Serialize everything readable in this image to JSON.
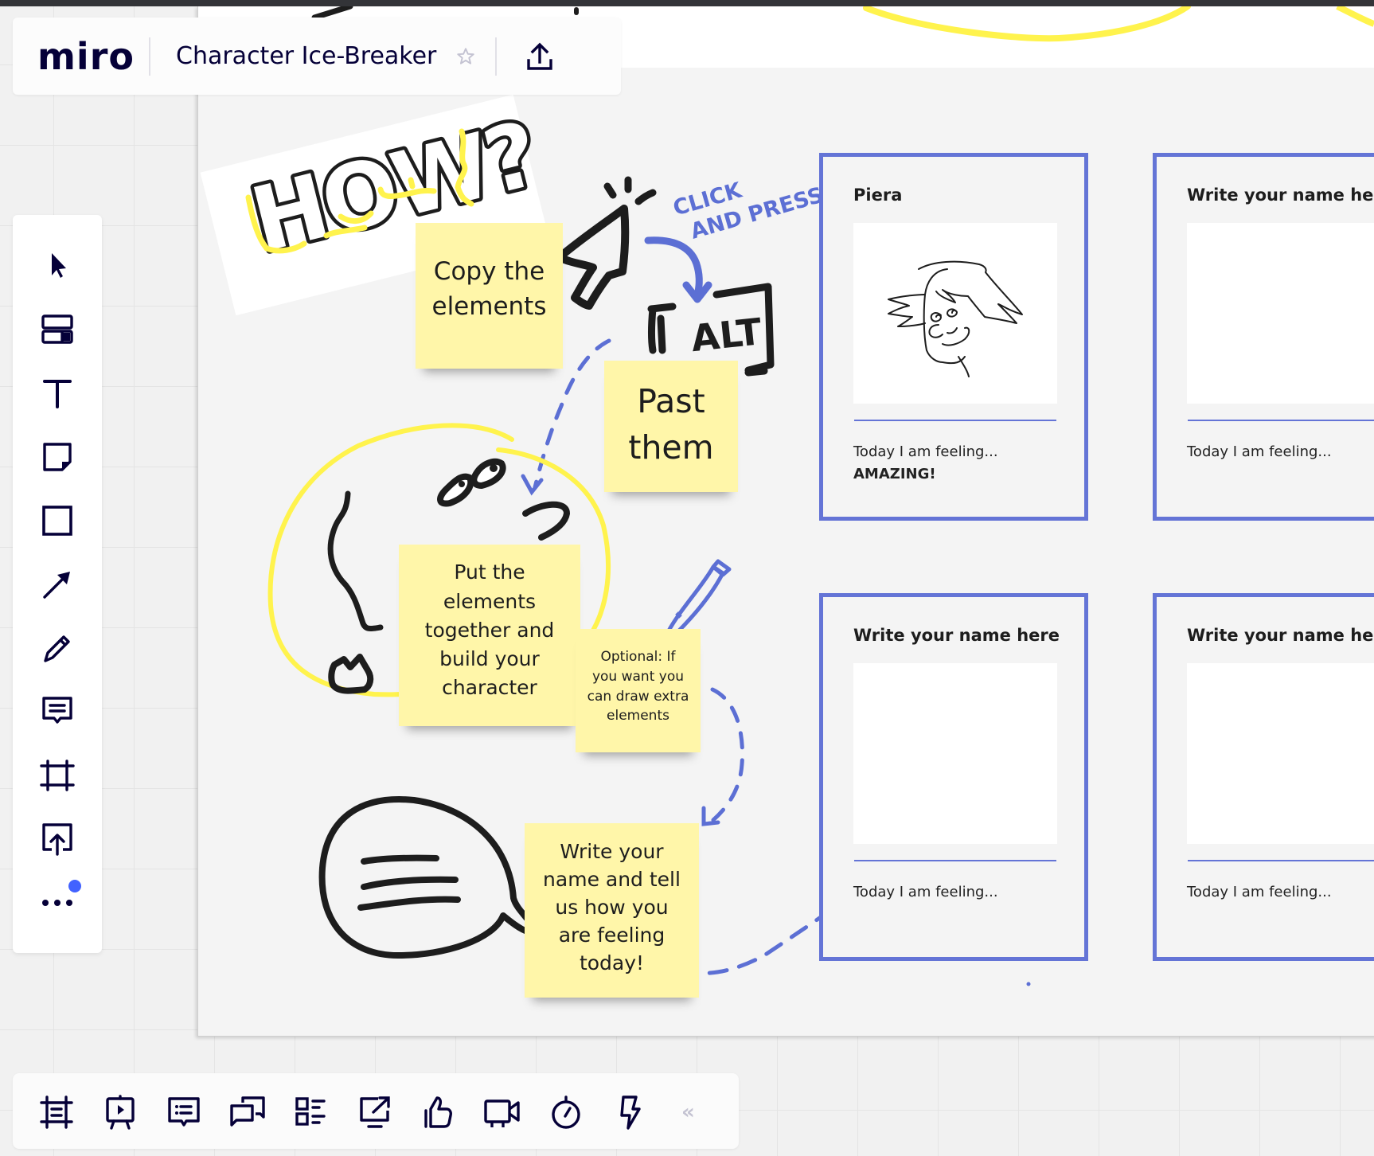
{
  "app": {
    "logo": "miro",
    "board_title": "Character Ice-Breaker",
    "header_icons": [
      "star-icon",
      "share-upload-icon"
    ]
  },
  "colors": {
    "brand_dark": "#050038",
    "card_border": "#6474d6",
    "sticky": "#fff6a9",
    "highlighter": "#fff34d",
    "notification_dot": "#4262ff",
    "ink_blue": "#5c6fd4"
  },
  "left_toolbar": {
    "tools": [
      {
        "id": "select",
        "icon": "cursor-arrow-icon"
      },
      {
        "id": "templates",
        "icon": "templates-icon"
      },
      {
        "id": "text",
        "icon": "text-icon"
      },
      {
        "id": "sticky-note",
        "icon": "sticky-note-icon"
      },
      {
        "id": "shape",
        "icon": "square-shape-icon"
      },
      {
        "id": "connection-line",
        "icon": "arrow-line-icon"
      },
      {
        "id": "pen",
        "icon": "pen-icon"
      },
      {
        "id": "comment",
        "icon": "comment-icon"
      },
      {
        "id": "frame",
        "icon": "frame-icon"
      },
      {
        "id": "upload",
        "icon": "upload-icon"
      },
      {
        "id": "more",
        "icon": "more-dots-icon"
      }
    ],
    "more_has_notification": true
  },
  "bottom_toolbar": {
    "tools": [
      {
        "id": "frames",
        "icon": "frames-icon"
      },
      {
        "id": "presentation",
        "icon": "presentation-icon"
      },
      {
        "id": "comments",
        "icon": "comments-icon"
      },
      {
        "id": "chat",
        "icon": "chat-icon"
      },
      {
        "id": "cards",
        "icon": "card-list-icon"
      },
      {
        "id": "screen-share",
        "icon": "screen-share-icon"
      },
      {
        "id": "voting",
        "icon": "thumbs-up-icon"
      },
      {
        "id": "video-chat",
        "icon": "video-camera-icon"
      },
      {
        "id": "timer",
        "icon": "timer-icon"
      },
      {
        "id": "activity",
        "icon": "lightning-icon"
      }
    ],
    "collapse_label": "«"
  },
  "board": {
    "how_label": "HOW?",
    "click_label_1": "CLICK",
    "click_label_2": "AND PRESS",
    "alt_label": "ALT",
    "stickies": [
      {
        "lines": [
          "Copy the",
          "elements"
        ]
      },
      {
        "lines": [
          "Past",
          "them"
        ]
      },
      {
        "lines": [
          "Put the",
          "elements",
          "together and",
          "build your",
          "character"
        ]
      },
      {
        "lines": [
          "Optional: If",
          "you want you",
          "can draw extra",
          "elements"
        ]
      },
      {
        "lines": [
          "Write your",
          "name and tell",
          "us how you",
          "are feeling",
          "today!"
        ]
      }
    ],
    "cards": [
      {
        "name": "Piera",
        "feeling_prompt": "Today I am feeling...",
        "feeling_value": "AMAZING!",
        "has_drawing": true
      },
      {
        "name": "Write your name here",
        "feeling_prompt": "Today I am feeling...",
        "feeling_value": "",
        "has_drawing": false
      },
      {
        "name": "Write your name here",
        "feeling_prompt": "Today I am feeling...",
        "feeling_value": "",
        "has_drawing": false
      },
      {
        "name": "Write your name here",
        "feeling_prompt": "Today I am feeling...",
        "feeling_value": "",
        "has_drawing": false
      }
    ]
  }
}
